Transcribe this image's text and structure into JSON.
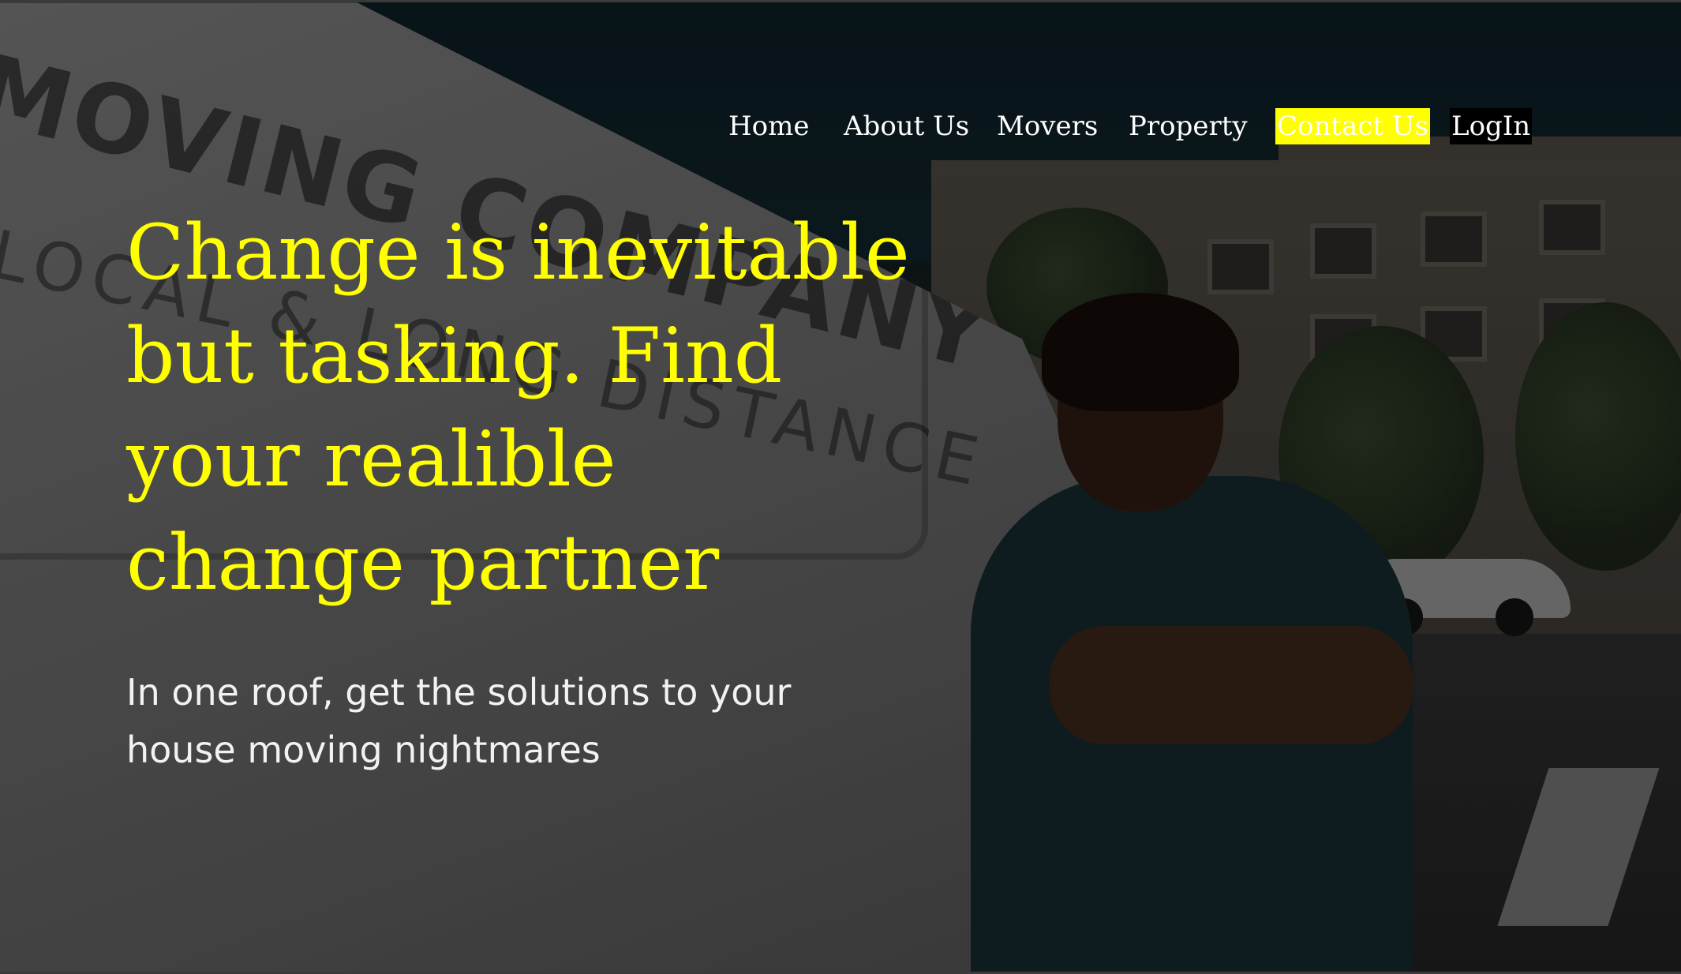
{
  "nav": {
    "items": [
      {
        "label": "Home"
      },
      {
        "label": "About Us"
      },
      {
        "label": "Movers"
      },
      {
        "label": "Property"
      },
      {
        "label": "Contact Us"
      },
      {
        "label": "LogIn"
      }
    ]
  },
  "hero": {
    "headline": "Change is inevitable but tasking. Find your realible change partner",
    "subheadline": "In one roof, get the solutions to your house moving nightmares",
    "background_van_text_line1": "MOVING COMPANY",
    "background_van_text_line2": "LOCAL & LONG DISTANCE"
  },
  "colors": {
    "accent": "#ffff00",
    "nav_text": "#ffffff",
    "login_bg": "#000000",
    "subheadline_text": "#f2f2f2"
  }
}
